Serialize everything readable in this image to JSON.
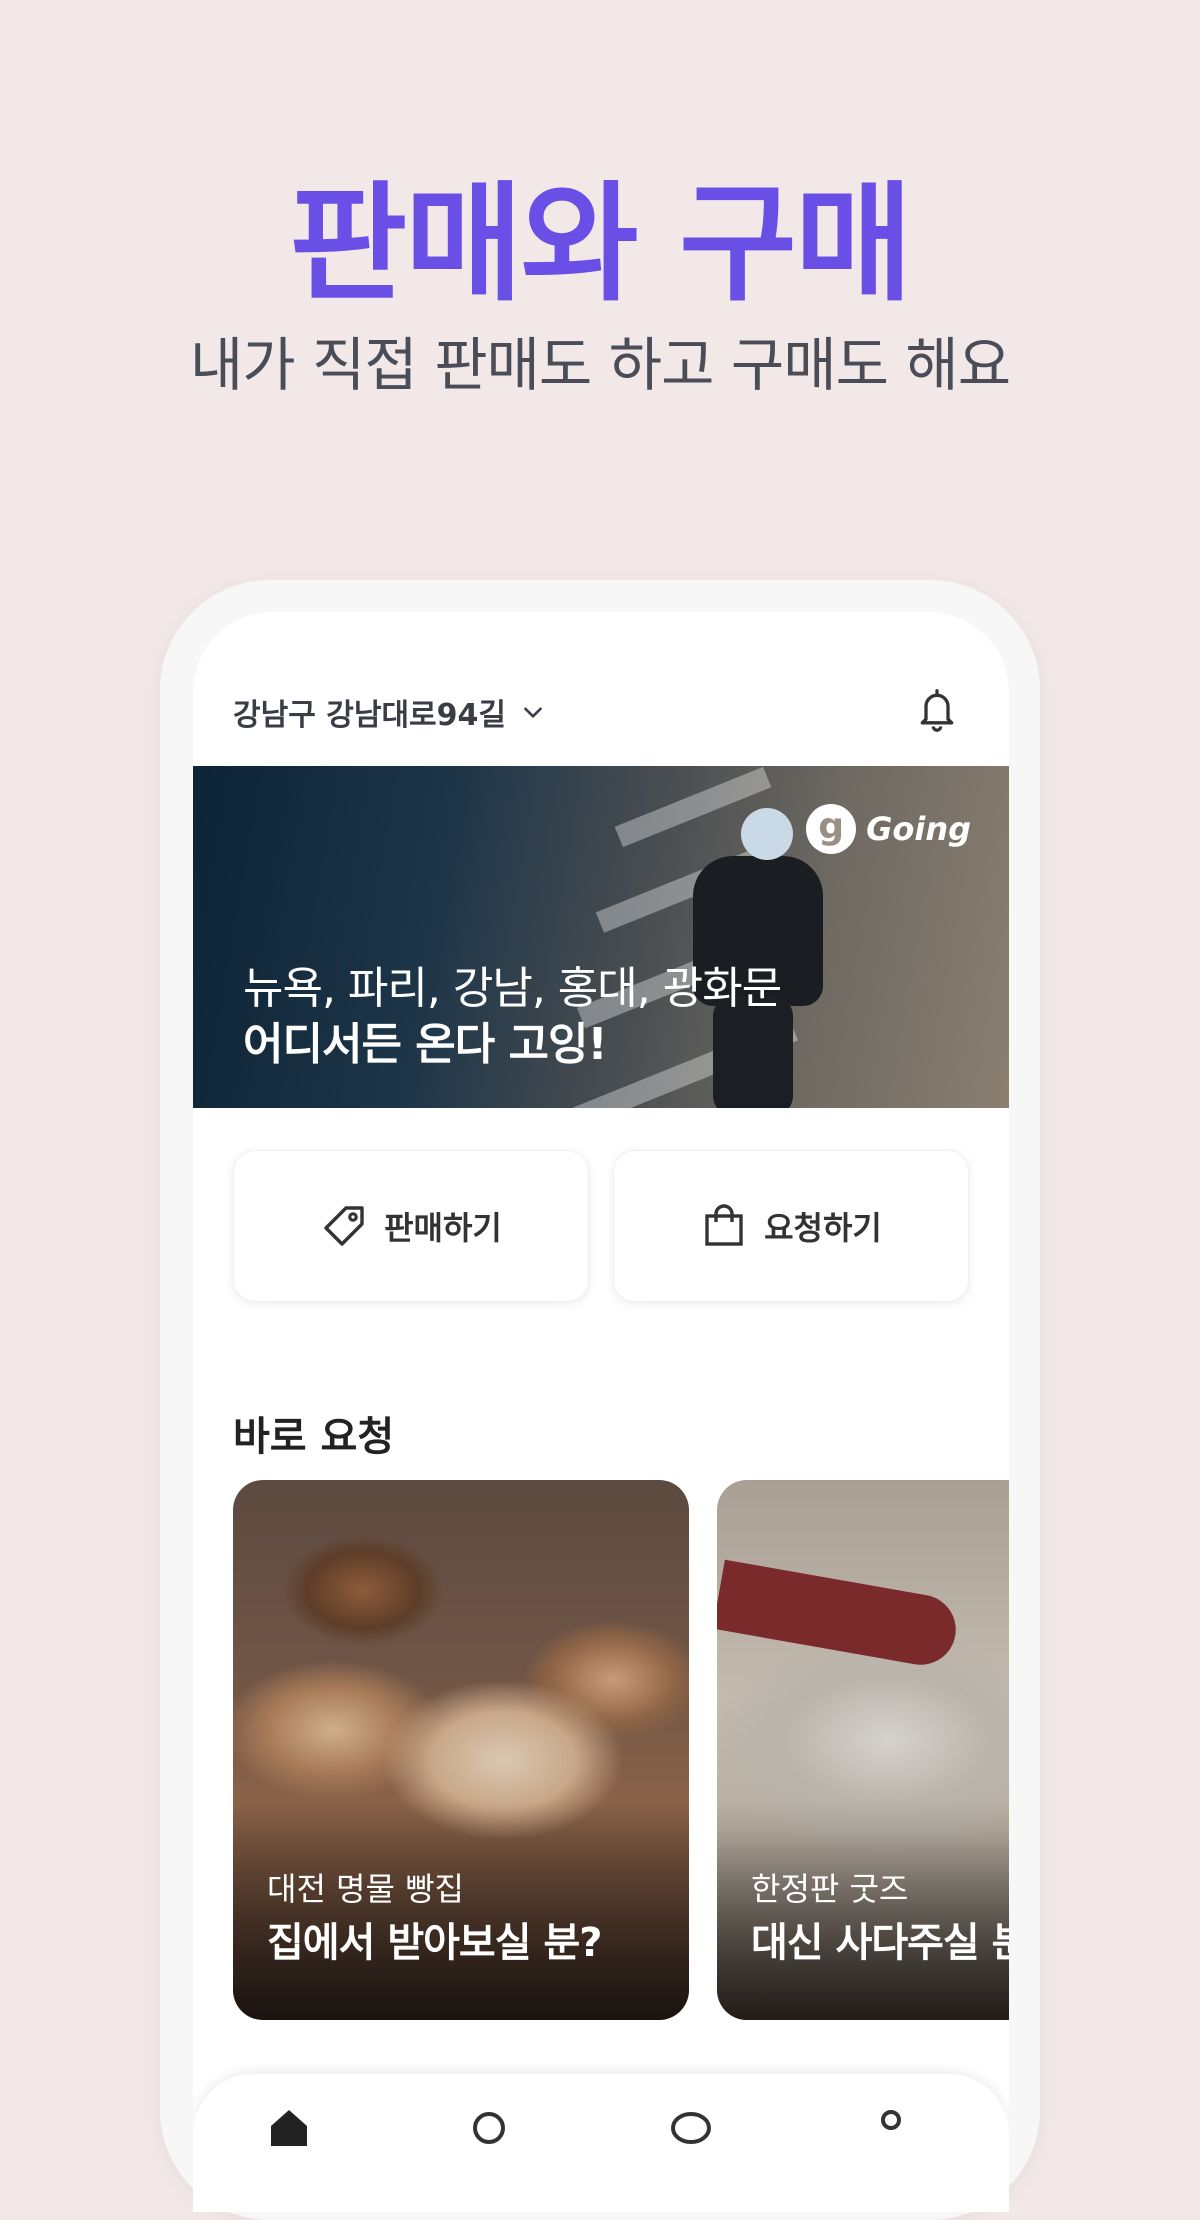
{
  "promo": {
    "title": "판매와 구매",
    "subtitle": "내가 직접 판매도 하고 구매도 해요"
  },
  "header": {
    "location": "강남구 강남대로94길"
  },
  "banner": {
    "logo_text": "Going",
    "logo_mark": "g",
    "line1": "뉴욕, 파리, 강남, 홍대, 광화문",
    "line2": "어디서든 온다 고잉!"
  },
  "actions": {
    "sell_label": "판매하기",
    "request_label": "요청하기"
  },
  "section": {
    "title": "바로 요청"
  },
  "cards": [
    {
      "subtitle": "대전 명물 빵집",
      "title": "집에서 받아보실 분?"
    },
    {
      "subtitle": "한정판 굿즈",
      "title": "대신 사다주실 분"
    }
  ],
  "icons": {
    "location_chevron": "chevron-down-icon",
    "notification": "bell-icon",
    "sell": "tag-icon",
    "request": "shopping-bag-icon",
    "tabs": [
      "home-icon",
      "search-icon",
      "chat-icon",
      "profile-icon"
    ]
  },
  "colors": {
    "accent": "#6a4fe6",
    "background": "#f2e8e7",
    "subtitle": "#4a4c57"
  }
}
